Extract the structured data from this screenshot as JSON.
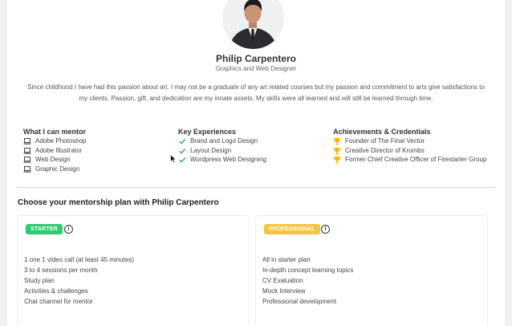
{
  "profile": {
    "name": "Philip Carpentero",
    "role": "Graphics and Web Designer",
    "bio": "Since childhood I have had this passion about art. I may not be a graduate of any art related courses but my passion and commitment to arts give satisfactions to my clients. Passion, gift, and dedication are my innate assets. My skills were all learned and will still be learned through time."
  },
  "mentor": {
    "title": "What I can mentor",
    "icon": "monitor-icon",
    "items": [
      "Adobe Photoshop",
      "Adobe Illustrator",
      "Web Design",
      "Graphic Design"
    ]
  },
  "experiences": {
    "title": "Key Experiences",
    "icon": "check-icon",
    "color": "#2e9e6a",
    "items": [
      "Brand and Logo Design",
      "Layout Design",
      "Wordpress Web Designing"
    ]
  },
  "achievements": {
    "title": "Achievements & Credentials",
    "icon": "trophy-icon",
    "color": "#f2b400",
    "items": [
      "Founder of The Final Vector",
      "Creative Director of Krumbs",
      "Former Chief Creative Officer of Firestarter Group"
    ]
  },
  "plans": {
    "heading": "Choose your mentorship plan with Philip Carpentero",
    "starter": {
      "badge": "STARTER",
      "color": "#2ecc71",
      "features": [
        "1 one 1 video call (at least 45 minutes)",
        "3 to 4 sessions per month",
        "Study plan",
        "Activities & challenges",
        "Chat channel for mentor"
      ]
    },
    "professional": {
      "badge": "PROFESSIONAL",
      "color": "#f5c542",
      "features": [
        "All in starter plan",
        "In-depth concept learning topics",
        "CV Evaluation",
        "Mock Interview",
        "Professional development"
      ]
    }
  }
}
